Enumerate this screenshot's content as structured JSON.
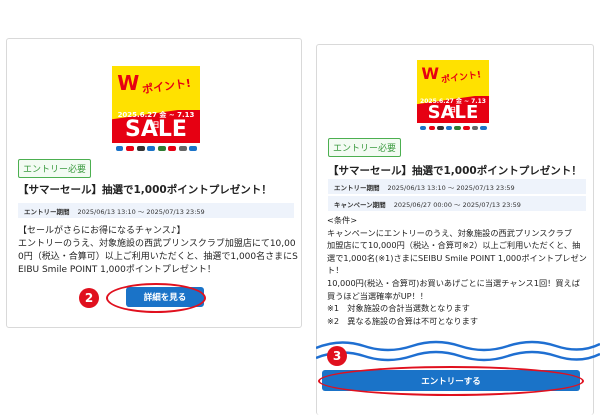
{
  "banner": {
    "top_word": "W",
    "point_word": "ポイント!",
    "dates": "2025.6.27 金 ~ 7.13 日",
    "sale_word": "SALE"
  },
  "left_card": {
    "badge": "エントリー必要",
    "title": "【サマーセール】抽選で1,000ポイントプレゼント！",
    "entry_period_label": "エントリー期間",
    "entry_period_value": "2025/06/13 13:10 ～ 2025/07/13 23:59",
    "body_lines": [
      "【セールがさらにお得になるチャンス♪】",
      "エントリーのうえ、対象施設の西武プリンスクラブ加盟店にて10,00",
      "0円（税込・合算可）以上ご利用いただくと、抽選で1,000名さまにS",
      "EIBU Smile POINT 1,000ポイントプレゼント！"
    ],
    "detail_button": "詳細を見る"
  },
  "right_card": {
    "badge": "エントリー必要",
    "title": "【サマーセール】抽選で1,000ポイントプレゼント！",
    "entry_period_label": "エントリー期間",
    "entry_period_value": "2025/06/13 13:10 ～ 2025/07/13 23:59",
    "campaign_period_label": "キャンペーン期間",
    "campaign_period_value": "2025/06/27 00:00 ～ 2025/07/13 23:59",
    "body_lines": [
      "<条件>",
      "キャンペーンにエントリーのうえ、対象施設の西武プリンスクラブ",
      "加盟店にて10,000円（税込・合算可※2）以上ご利用いただくと、抽",
      "選で1,000名(※1)さまにSEIBU Smile POINT 1,000ポイントプレゼン",
      "ト！",
      "10,000円(税込・合算可)お買いあげごとに当選チャンス1回！買えば",
      "買うほど当選確率がUP！！",
      "※1　対象施設の合計当選数となります",
      "※2　異なる施設の合算は不可となります"
    ],
    "entry_button": "エントリーする"
  },
  "steps": {
    "step_2": "2",
    "step_3": "3"
  },
  "colors": {
    "button_blue": "#1a73c8",
    "highlight_red": "#e0101e",
    "badge_green": "#3b9a3f",
    "sale_red": "#e60012",
    "sale_yellow": "#ffe100",
    "wave_blue": "#1f6fd1"
  }
}
